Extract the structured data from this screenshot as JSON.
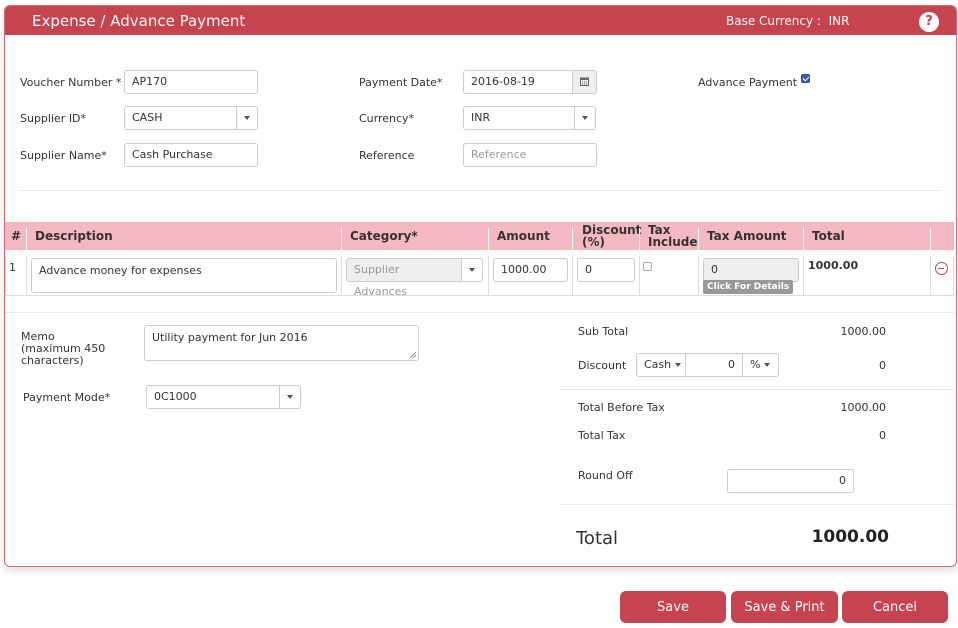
{
  "header": {
    "title": "Expense / Advance Payment",
    "base_currency_label": "Base Currency :",
    "base_currency_value": "INR",
    "help_icon": "?"
  },
  "form": {
    "voucher_number": {
      "label": "Voucher Number *",
      "value": "AP170"
    },
    "supplier_id": {
      "label": "Supplier ID*",
      "value": "CASH"
    },
    "supplier_name": {
      "label": "Supplier Name*",
      "value": "Cash Purchase"
    },
    "payment_date": {
      "label": "Payment Date*",
      "value": "2016-08-19"
    },
    "currency": {
      "label": "Currency*",
      "value": "INR"
    },
    "reference": {
      "label": "Reference",
      "value": "",
      "placeholder": "Reference"
    },
    "advance_payment": {
      "label": "Advance Payment",
      "checked": true
    }
  },
  "grid": {
    "columns": [
      "#",
      "Description",
      "Category*",
      "Amount",
      "Discount (%)",
      "Tax Include",
      "Tax Amount",
      "Total"
    ],
    "discount_col": [
      "Discount",
      "(%)"
    ],
    "tax_include_col": [
      "Tax",
      "Include"
    ],
    "rows": [
      {
        "index": "1",
        "description": "Advance money for expenses",
        "category": "Supplier Advances",
        "amount": "1000.00",
        "discount": "0",
        "tax_include": false,
        "tax_amount": "0",
        "details_label": "Click For Details",
        "total": "1000.00"
      }
    ]
  },
  "memo": {
    "label_lines": [
      "Memo",
      "(maximum 450",
      "characters)"
    ],
    "value": "Utility payment for Jun 2016"
  },
  "payment_mode": {
    "label": "Payment Mode*",
    "value": "0C1000"
  },
  "summary": {
    "sub_total": {
      "label": "Sub Total",
      "value": "1000.00"
    },
    "discount": {
      "label": "Discount",
      "type": "Cash",
      "amount": "0",
      "unit": "%",
      "value": "0"
    },
    "total_before_tax": {
      "label": "Total Before Tax",
      "value": "1000.00"
    },
    "total_tax": {
      "label": "Total Tax",
      "value": "0"
    },
    "round_off": {
      "label": "Round Off",
      "value": "0"
    },
    "total": {
      "label": "Total",
      "value": "1000.00"
    }
  },
  "actions": {
    "save": "Save",
    "save_print": "Save & Print",
    "cancel": "Cancel"
  },
  "colors": {
    "brand": "#c6444f",
    "grid_header": "#f4b9c0"
  }
}
